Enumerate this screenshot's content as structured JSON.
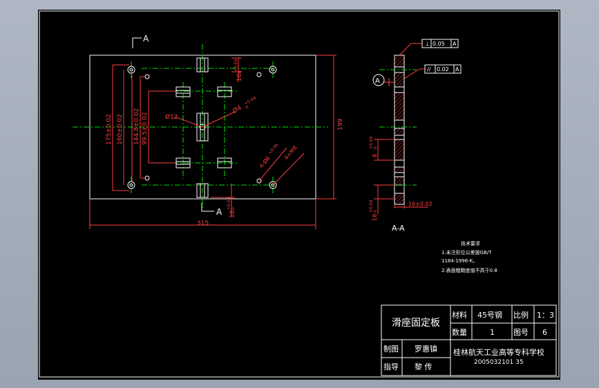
{
  "section": {
    "cut_label": "A",
    "view_label": "A-A",
    "datum_label": "A"
  },
  "dimensions": {
    "width": "315",
    "height": "199",
    "d175": "175±0.02",
    "d160": "160±0.02",
    "d144": "144.8±0.02",
    "d99": "99.5±0.02",
    "top_16": "16",
    "top_16_tol": "+0.04",
    "top_16_tol2": "0",
    "bottom_18": "18",
    "bottom_18_tol": "+0.04",
    "bottom_18_tol2": "0",
    "dia12": "Ø12",
    "dia4": "Ø4",
    "dia4_tol": "+0.04",
    "dia4_tol2": "0",
    "holes_4xm8": "4×M8",
    "holes_4xdia6": "4-Ø6",
    "holes_4xdia6_tol": "+0.06",
    "side_8": "8",
    "side_8_tol": "+0.04",
    "side_8_tol2": "0",
    "side_18": "18",
    "side_18_tol": "+0.04",
    "side_18_tol2": "0",
    "side_16": "16±0.02"
  },
  "tolerances": {
    "perp_symbol": "⊥",
    "perp_value": "0.05",
    "perp_datum": "A",
    "par_symbol": "//",
    "par_value": "0.02",
    "par_datum": "A"
  },
  "tech_notes": {
    "title": "技术要求",
    "line1": "1.未注形位公差按GB/T",
    "line2": "1184-1996-K。",
    "line3": "2.表面粗糙度值不高于0.8"
  },
  "title_block": {
    "part_name": "滑座固定板",
    "material_label": "材料",
    "material_value": "45号钢",
    "scale_label": "比例",
    "scale_value": "1：3",
    "quantity_label": "数量",
    "quantity_value": "1",
    "drawing_no_label": "图号",
    "drawing_no_value": "6",
    "drawn_label": "制图",
    "drawn_value": "罗惠镇",
    "guide_label": "指导",
    "guide_value": "黎  传",
    "school": "桂林航天工业高等专科学校",
    "student_id": "2005032101 35"
  },
  "colors": {
    "background": "#000000",
    "outline": "#ffffff",
    "dimension": "#ff4040",
    "centerline": "#00e000",
    "hatch": "#ff4040",
    "title_block": "#ffffff"
  }
}
